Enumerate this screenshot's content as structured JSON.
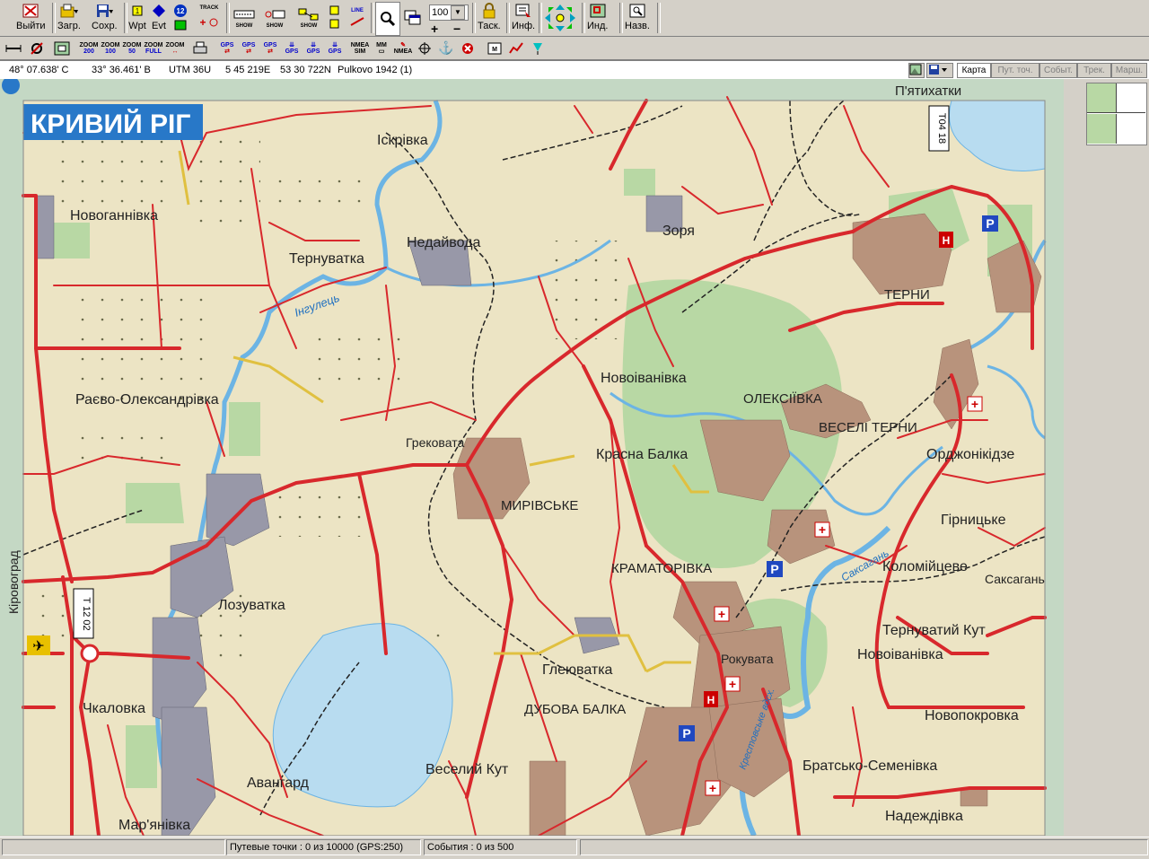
{
  "toolbar": {
    "exit": "Выйти",
    "load": "Загр.",
    "save": "Сохр.",
    "wpt": "Wpt",
    "evt": "Evt",
    "wpt_count_badge": "12",
    "track": "TRACK",
    "task": "Таск.",
    "info": "Инф.",
    "ind": "Инд.",
    "names": "Назв.",
    "zoom_value": "100",
    "show": "SHOW",
    "line": "LINE",
    "zoom_labels": [
      "ZOOM 200",
      "ZOOM 100",
      "ZOOM 50",
      "ZOOM FULL",
      "ZOOM"
    ],
    "zoom_items": [
      {
        "top": "ZOOM",
        "bottom": "200"
      },
      {
        "top": "ZOOM",
        "bottom": "100"
      },
      {
        "top": "ZOOM",
        "bottom": "50"
      },
      {
        "top": "ZOOM",
        "bottom": "FULL"
      },
      {
        "top": "ZOOM",
        "bottom": ""
      }
    ],
    "gps": "GPS",
    "nmea": "NMEA",
    "sim": "SIM",
    "mm": "MM"
  },
  "coords": {
    "lat": "48° 07.638' С",
    "lon": "33° 36.461' В",
    "utm_zone": "UTM  36U",
    "easting": "5 45 219E",
    "northing": "53 30 722N",
    "datum": "Pulkovo 1942 (1)"
  },
  "tabs": [
    "Карта",
    "Пут. точ.",
    "Событ.",
    "Трек.",
    "Марш."
  ],
  "map": {
    "title": "КРИВИЙ РІГ",
    "places": {
      "iskrivka": "Іскрівка",
      "novohannivka": "Новоганнівка",
      "ternuvatka": "Тернуватка",
      "nedaivoda": "Недайвода",
      "zorya": "Зоря",
      "terny": "ТЕРНИ",
      "piatykhatky": "П'ятихатки",
      "inhulets": "Інгулець",
      "raevo": "Раєво-Олександрівка",
      "novoivanivka1": "Новоіванівка",
      "oleksiivka": "ОЛЕКСІЇВКА",
      "veseli_terny": "ВЕСЕЛІ ТЕРНИ",
      "hrekovata": "Грековата",
      "krasna_balka": "Красна Балка",
      "ordzhonikidze": "Орджонікідзе",
      "myrivske": "МИРІВСЬКЕ",
      "hirnytske": "Гірницьке",
      "kramatorivka": "КРАМАТОРІВКА",
      "kolomiitseve": "Коломійцеве",
      "saksahan": "Саксагань",
      "kirovohrad": "Кіровоград",
      "lozuvatka": "Лозуватка",
      "ternuvatyi_kut": "Тернуватий Кут",
      "novoivanivka2": "Новоіванівка",
      "rokuvata": "Рокувата",
      "hleiuvatka": "Глеюватка",
      "chkalovka": "Чкаловка",
      "dubova_balka": "ДУБОВА БАЛКА",
      "novopokrovka": "Новопокровка",
      "veselyi_kut": "Веселий Кут",
      "bratsko": "Братсько-Семенівка",
      "avanhard": "Авангард",
      "nadezhdivka": "Надеждівка",
      "marianivka": "Мар'янівка",
      "saksahan_river": "Саксагань",
      "krestovskoe": "Крестовське вдсх."
    },
    "road_codes": {
      "t0418": "Т04 18",
      "t1202": "Т 12 02"
    }
  },
  "status": {
    "waypoints": "Путевые точки : 0 из 10000  (GPS:250)",
    "events": "События : 0 из 500"
  },
  "colors": {
    "road": "#d8282c",
    "land": "#ece4c4",
    "forest": "#b8d8a4",
    "water": "#b8dcf0",
    "river": "#6cb4e4",
    "urban": "#b8937c",
    "title_bg": "#2878c8",
    "border": "#c4d8c4"
  }
}
